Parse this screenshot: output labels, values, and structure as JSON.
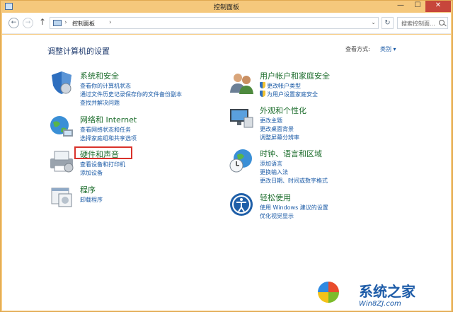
{
  "window": {
    "title": "控制面板"
  },
  "titlebar": {
    "minimize": "—",
    "maximize": "☐",
    "close": "✕"
  },
  "nav": {
    "back": "←",
    "forward": "→",
    "up": "↑",
    "refresh": "↻"
  },
  "address": {
    "separator": "›",
    "path": "控制面板",
    "trailing": "›",
    "dropdown": "⌄"
  },
  "search": {
    "placeholder": "搜索控制面..."
  },
  "main": {
    "title": "调整计算机的设置",
    "view_label": "查看方式:",
    "view_value": "类别 ▾"
  },
  "categories_left": [
    {
      "title": "系统和安全",
      "icon": "shield-icon",
      "links": [
        "查看你的计算机状态",
        "通过文件历史记录保存你的文件备份副本",
        "查找并解决问题"
      ]
    },
    {
      "title": "网络和 Internet",
      "icon": "globe-network-icon",
      "links": [
        "查看网络状态和任务",
        "选择家庭组和共享选项"
      ]
    },
    {
      "title": "硬件和声音",
      "icon": "printer-icon",
      "links": [
        "查看设备和打印机",
        "添加设备"
      ]
    },
    {
      "title": "程序",
      "icon": "programs-icon",
      "links": [
        "卸载程序"
      ]
    }
  ],
  "categories_right": [
    {
      "title": "用户帐户和家庭安全",
      "icon": "users-icon",
      "links": [
        "更改帐户类型",
        "为用户设置家庭安全"
      ]
    },
    {
      "title": "外观和个性化",
      "icon": "monitor-icon",
      "links": [
        "更改主题",
        "更改桌面背景",
        "调整屏幕分辨率"
      ]
    },
    {
      "title": "时钟、语言和区域",
      "icon": "clock-globe-icon",
      "links": [
        "添加语言",
        "更换输入法",
        "更改日期、时间或数字格式"
      ]
    },
    {
      "title": "轻松使用",
      "icon": "ease-of-access-icon",
      "links": [
        "使用 Windows 建议的设置",
        "优化视觉显示"
      ]
    }
  ],
  "watermark": {
    "text": "系统之家",
    "url": "Win8ZJ.com"
  },
  "colors": {
    "title_bar": "#f5c87c",
    "category_title": "#1e6e2e",
    "link": "#1a5aa6",
    "highlight": "#d9322b"
  }
}
